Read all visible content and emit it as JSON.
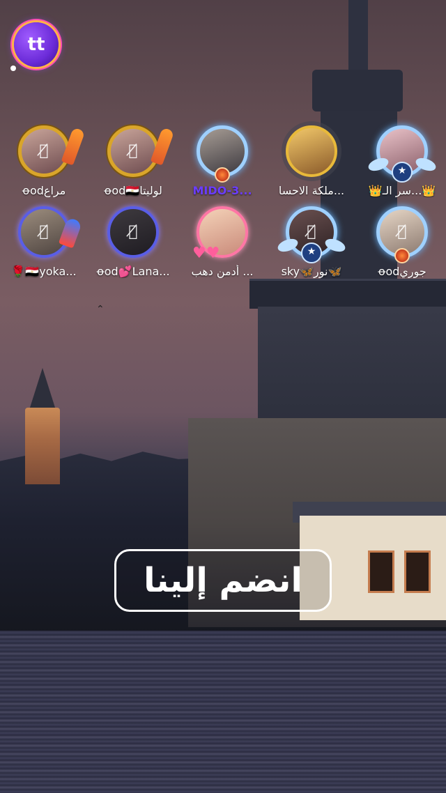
{
  "app": {
    "logo_text": "tt"
  },
  "seats_row1": [
    {
      "name": "ꝋodمراع",
      "frame": "gold"
    },
    {
      "name": "ꝋod🇪🇬لوليتا",
      "frame": "gold"
    },
    {
      "name": "MIDO-3...",
      "frame": "blue"
    },
    {
      "name": "ملكة الاحسا...",
      "frame": "dark"
    },
    {
      "name": "👑سر الـ...👑",
      "frame": "blue"
    }
  ],
  "seats_row2": [
    {
      "name": "🌹🇪🇬yoka...",
      "frame": "purple"
    },
    {
      "name": "ꝋod💕Lana...",
      "frame": "purple"
    },
    {
      "name": "أدمن دهب ...",
      "frame": "pink"
    },
    {
      "name": "sky🦋نور🦋",
      "frame": "blue"
    },
    {
      "name": "ꝋodجوري",
      "frame": "blue"
    }
  ],
  "join_button": {
    "label": "انضم إلينا"
  },
  "icons": {
    "mic_off": "mic-off-icon",
    "logo": "chat-bubble-logo"
  }
}
